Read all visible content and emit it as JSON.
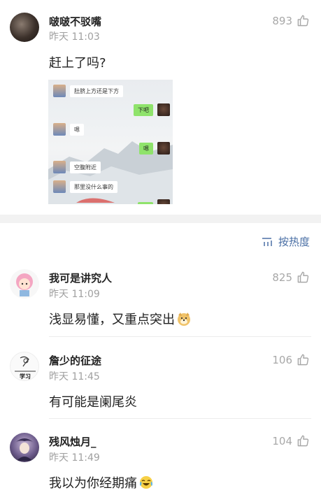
{
  "post": {
    "username": "啵啵不驳嘴",
    "time": "昨天 11:03",
    "likes": "893",
    "text": "赶上了吗?",
    "chat": [
      {
        "side": "left",
        "text": "肚脐上方还是下方"
      },
      {
        "side": "right",
        "text": "下吧"
      },
      {
        "side": "left",
        "text": "嗯"
      },
      {
        "side": "right",
        "text": "嗯"
      },
      {
        "side": "left",
        "text": "空腹附近"
      },
      {
        "side": "left",
        "text": "那里没什么事的"
      }
    ]
  },
  "sort": {
    "label": "按热度"
  },
  "comments": [
    {
      "username": "我可是讲究人",
      "time": "昨天 11:09",
      "likes": "825",
      "text": "浅显易懂，又重点突出",
      "emoji": "doge-emoji"
    },
    {
      "username": "詹少的征途",
      "time": "昨天 11:45",
      "likes": "106",
      "text": "有可能是阑尾炎",
      "avatar_text": "学习"
    },
    {
      "username": "残风烛月_",
      "time": "昨天 11:49",
      "likes": "104",
      "text": "我以为你经期痛",
      "emoji": "laugh-cry-emoji"
    }
  ],
  "colors": {
    "accent": "#4a6fa5",
    "muted": "#a0a0a0",
    "chat_green": "#8fe36b"
  }
}
